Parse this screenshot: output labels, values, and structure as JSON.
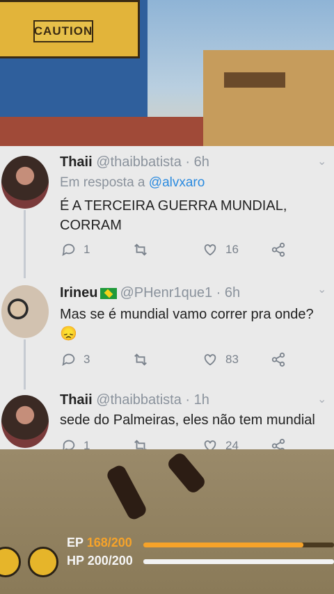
{
  "scene": {
    "caution_sign": "CAUTION"
  },
  "tweets": [
    {
      "name": "Thaii",
      "handle": "@thaibbatista · 6h",
      "reply_prefix": "Em resposta a",
      "reply_mention": "@alvxaro",
      "text": "É A TERCEIRA GUERRA MUNDIAL,\nCORRAM",
      "reply_count": "1",
      "retweet_count": "",
      "like_count": "16"
    },
    {
      "name": "Irineu",
      "handle": "@PHenr1que1 · 6h",
      "text": "Mas se é mundial vamo correr pra onde?",
      "emoji": "😞",
      "reply_count": "3",
      "retweet_count": "",
      "like_count": "83"
    },
    {
      "name": "Thaii",
      "handle": "@thaibbatista · 1h",
      "text": "sede do Palmeiras, eles não tem mundial",
      "reply_count": "1",
      "retweet_count": "",
      "like_count": "24"
    }
  ],
  "hud": {
    "ep_label": "EP",
    "ep_value": "168/200",
    "ep_fraction": 0.84,
    "hp_label": "HP",
    "hp_value": "200/200",
    "hp_fraction": 1.0,
    "ep_color": "#f6a32a",
    "hp_color": "#f2f2f2"
  },
  "icons": {
    "reply": "reply-icon",
    "retweet": "retweet-icon",
    "like": "heart-icon",
    "share": "share-icon",
    "chevron": "chevron-down-icon",
    "flag": "brazil-flag-icon",
    "helmet": "helmet-icon",
    "backpack": "backpack-icon"
  }
}
